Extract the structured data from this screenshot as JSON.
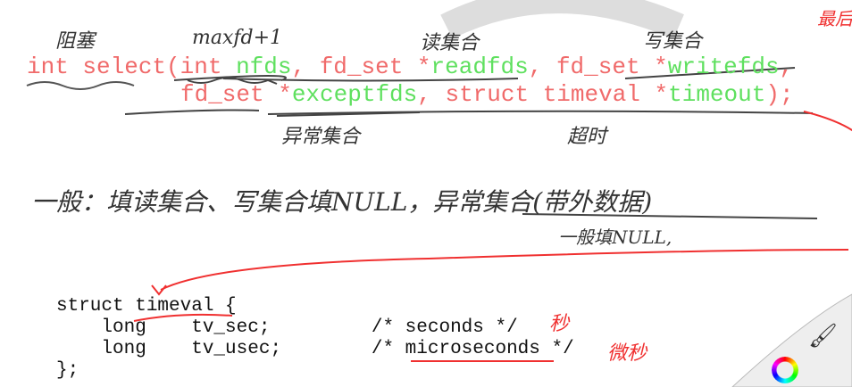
{
  "signature": {
    "line1": {
      "ret": "int select(",
      "p1type": "int ",
      "p1": "nfds",
      ",1": ", fd_set *",
      "p2": "readfds",
      ",2": ", fd_set *",
      "p3": "writefds",
      ",3": ","
    },
    "line2": {
      "t4": "fd_set *",
      "p4": "exceptfds",
      "mid": ", struct timeval *",
      "p5": "timeout",
      "end": ");"
    }
  },
  "notes": {
    "blocking": "阻塞",
    "maxfd": "maxfd+1",
    "read_set": "读集合",
    "write_set": "写集合",
    "except_set": "异常集合",
    "timeout": "超时",
    "general": "一般：填读集合、写集合填NULL，异常集合(带外数据)",
    "general_null": "一般填NULL,",
    "seconds": "秒",
    "microseconds": "微秒",
    "last": "最后"
  },
  "struct": {
    "l1": "struct timeval {",
    "l2": "    long    tv_sec;         /* seconds */",
    "l3": "    long    tv_usec;        /* microseconds */",
    "l4": "};"
  },
  "tools": {
    "color_wheel": "color-wheel-icon",
    "brush": "brush-icon"
  }
}
